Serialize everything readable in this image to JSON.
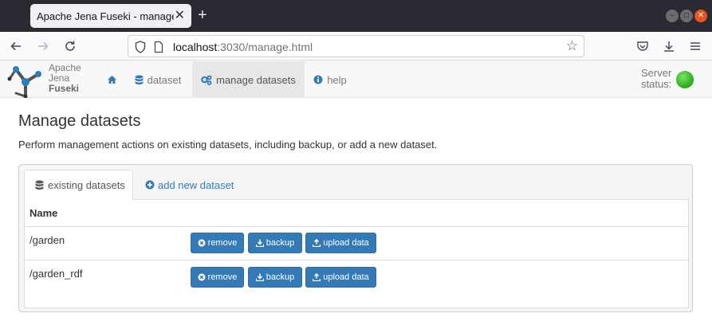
{
  "browser": {
    "tab_title": "Apache Jena Fuseki - manage.html",
    "url_host": "localhost",
    "url_rest": ":3030/manage.html"
  },
  "app": {
    "brand": [
      "Apache",
      "Jena",
      "Fuseki"
    ],
    "nav": [
      {
        "label": "",
        "icon": "home-icon"
      },
      {
        "label": "dataset",
        "icon": "database-icon"
      },
      {
        "label": "manage datasets",
        "icon": "cogs-icon"
      },
      {
        "label": "help",
        "icon": "info-icon"
      }
    ],
    "server_status_label_1": "Server",
    "server_status_label_2": "status:",
    "server_status_color": "#2fb31f"
  },
  "page": {
    "title": "Manage datasets",
    "description": "Perform management actions on existing datasets, including backup, or add a new dataset."
  },
  "panel": {
    "tabs": [
      {
        "label": "existing datasets",
        "icon": "database-icon"
      },
      {
        "label": "add new dataset",
        "icon": "plus-circle-icon"
      }
    ],
    "column_header": "Name",
    "rows": [
      {
        "name": "/garden"
      },
      {
        "name": "/garden_rdf"
      }
    ],
    "actions": {
      "remove": "remove",
      "backup": "backup",
      "upload": "upload data"
    }
  },
  "colors": {
    "primary": "#337ab7",
    "browser_chrome": "#2b2a33"
  }
}
